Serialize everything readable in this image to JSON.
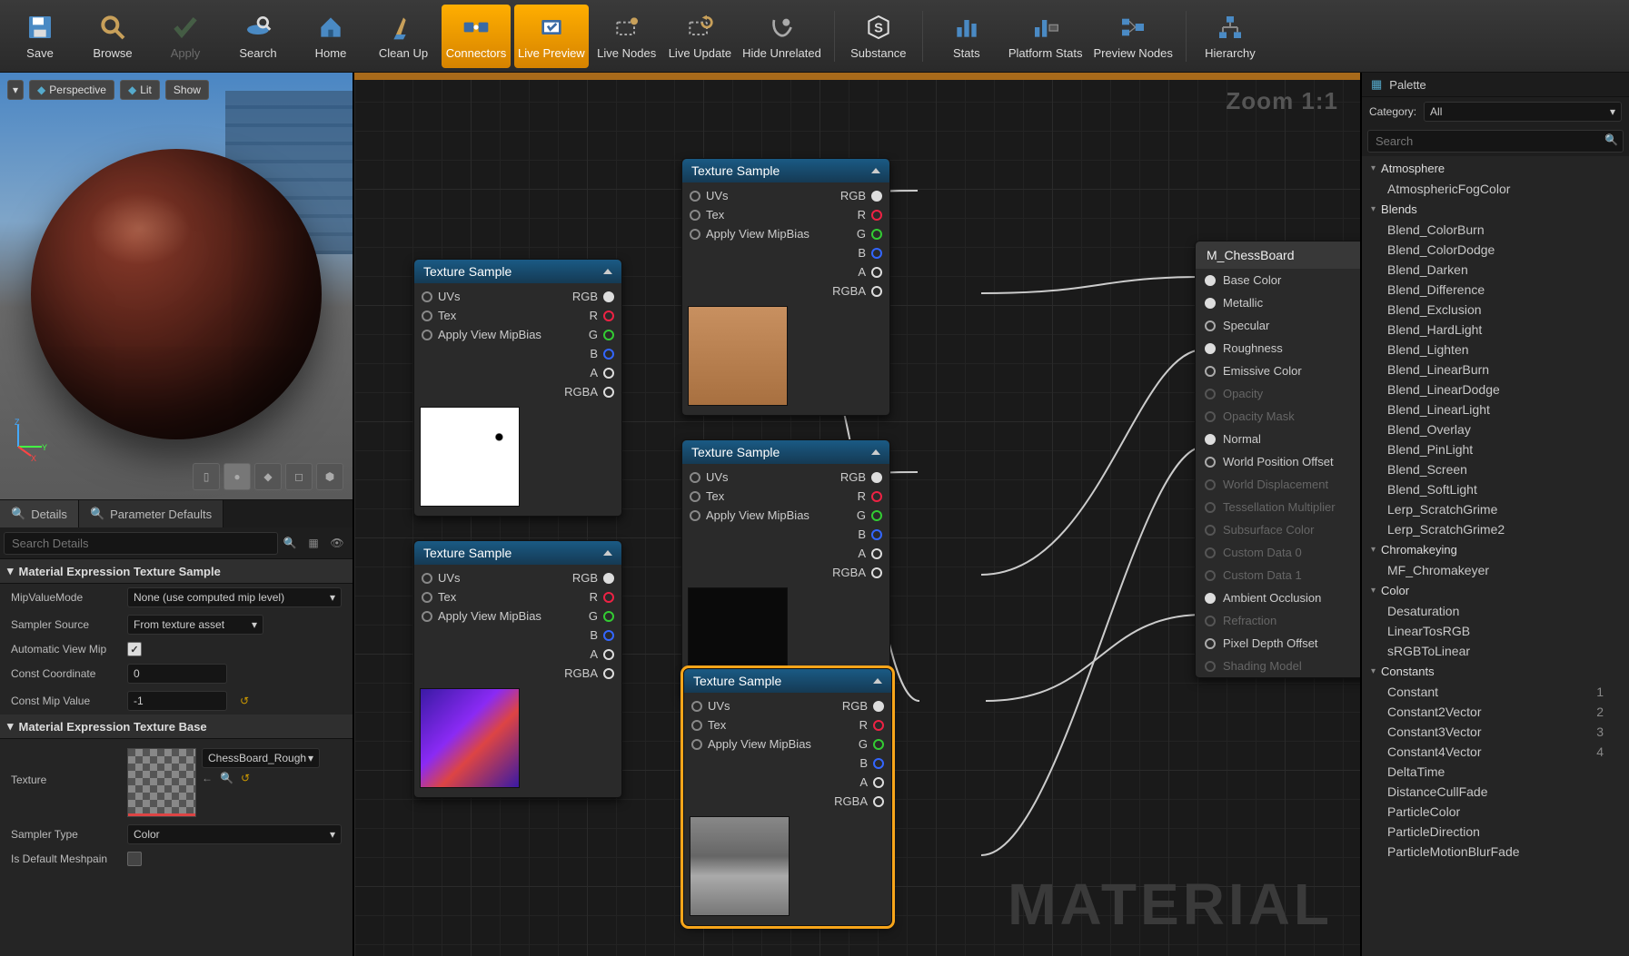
{
  "toolbar": [
    {
      "id": "save",
      "label": "Save",
      "icon": "floppy"
    },
    {
      "id": "browse",
      "label": "Browse",
      "icon": "browse"
    },
    {
      "id": "apply",
      "label": "Apply",
      "icon": "apply",
      "dim": true
    },
    {
      "id": "search",
      "label": "Search",
      "icon": "search"
    },
    {
      "id": "home",
      "label": "Home",
      "icon": "home"
    },
    {
      "id": "cleanup",
      "label": "Clean Up",
      "icon": "cleanup"
    },
    {
      "id": "connectors",
      "label": "Connectors",
      "icon": "connectors",
      "active": true
    },
    {
      "id": "livepreview",
      "label": "Live Preview",
      "icon": "preview",
      "active": true
    },
    {
      "id": "livenodes",
      "label": "Live Nodes",
      "icon": "livenodes"
    },
    {
      "id": "liveupdate",
      "label": "Live Update",
      "icon": "liveupdate"
    },
    {
      "id": "hideunrel",
      "label": "Hide Unrelated",
      "icon": "hide"
    },
    {
      "id": "substance",
      "label": "Substance",
      "icon": "substance",
      "sep": true
    },
    {
      "id": "stats",
      "label": "Stats",
      "icon": "stats",
      "sep": true
    },
    {
      "id": "platstats",
      "label": "Platform Stats",
      "icon": "platstats"
    },
    {
      "id": "prevnodes",
      "label": "Preview Nodes",
      "icon": "prevnodes"
    },
    {
      "id": "hierarchy",
      "label": "Hierarchy",
      "icon": "hierarchy",
      "sep": true
    }
  ],
  "viewport": {
    "menu_btn": "▾",
    "perspective": "Perspective",
    "lit": "Lit",
    "show": "Show"
  },
  "details_tabs": {
    "details": "Details",
    "paramdef": "Parameter Defaults"
  },
  "details_search_placeholder": "Search Details",
  "details": {
    "sec1": "Material Expression Texture Sample",
    "mipmode_lbl": "MipValueMode",
    "mipmode_val": "None (use computed mip level)",
    "sampler_lbl": "Sampler Source",
    "sampler_val": "From texture asset",
    "autoview_lbl": "Automatic View Mip",
    "autoview_checked": true,
    "constcoord_lbl": "Const Coordinate",
    "constcoord_val": "0",
    "constmip_lbl": "Const Mip Value",
    "constmip_val": "-1",
    "sec2": "Material Expression Texture Base",
    "texture_lbl": "Texture",
    "texture_val": "ChessBoard_Rough",
    "samplertype_lbl": "Sampler Type",
    "samplertype_val": "Color",
    "defaultmesh_lbl": "Is Default Meshpain"
  },
  "graph": {
    "zoom": "Zoom 1:1",
    "watermark": "MATERIAL",
    "texsample_hdr": "Texture Sample",
    "pins_in": [
      "UVs",
      "Tex",
      "Apply View MipBias"
    ],
    "pins_out": [
      "RGB",
      "R",
      "G",
      "B",
      "A",
      "RGBA"
    ],
    "matnode_title": "M_ChessBoard",
    "mat_inputs": [
      {
        "label": "Base Color",
        "filled": true
      },
      {
        "label": "Metallic",
        "filled": true
      },
      {
        "label": "Specular",
        "ring": true
      },
      {
        "label": "Roughness",
        "filled": true
      },
      {
        "label": "Emissive Color",
        "ring": true
      },
      {
        "label": "Opacity",
        "dim": true
      },
      {
        "label": "Opacity Mask",
        "dim": true
      },
      {
        "label": "Normal",
        "filled": true
      },
      {
        "label": "World Position Offset",
        "ring": true
      },
      {
        "label": "World Displacement",
        "dim": true
      },
      {
        "label": "Tessellation Multiplier",
        "dim": true
      },
      {
        "label": "Subsurface Color",
        "dim": true
      },
      {
        "label": "Custom Data 0",
        "dim": true
      },
      {
        "label": "Custom Data 1",
        "dim": true
      },
      {
        "label": "Ambient Occlusion",
        "filled": true
      },
      {
        "label": "Refraction",
        "dim": true
      },
      {
        "label": "Pixel Depth Offset",
        "ring": true
      },
      {
        "label": "Shading Model",
        "dim": true
      }
    ]
  },
  "palette": {
    "tab": "Palette",
    "category_lbl": "Category:",
    "category_val": "All",
    "search_placeholder": "Search",
    "groups": [
      {
        "name": "Atmosphere",
        "items": [
          {
            "n": "AtmosphericFogColor"
          }
        ]
      },
      {
        "name": "Blends",
        "items": [
          {
            "n": "Blend_ColorBurn"
          },
          {
            "n": "Blend_ColorDodge"
          },
          {
            "n": "Blend_Darken"
          },
          {
            "n": "Blend_Difference"
          },
          {
            "n": "Blend_Exclusion"
          },
          {
            "n": "Blend_HardLight"
          },
          {
            "n": "Blend_Lighten"
          },
          {
            "n": "Blend_LinearBurn"
          },
          {
            "n": "Blend_LinearDodge"
          },
          {
            "n": "Blend_LinearLight"
          },
          {
            "n": "Blend_Overlay"
          },
          {
            "n": "Blend_PinLight"
          },
          {
            "n": "Blend_Screen"
          },
          {
            "n": "Blend_SoftLight"
          },
          {
            "n": "Lerp_ScratchGrime"
          },
          {
            "n": "Lerp_ScratchGrime2"
          }
        ]
      },
      {
        "name": "Chromakeying",
        "items": [
          {
            "n": "MF_Chromakeyer"
          }
        ]
      },
      {
        "name": "Color",
        "items": [
          {
            "n": "Desaturation"
          },
          {
            "n": "LinearTosRGB"
          },
          {
            "n": "sRGBToLinear"
          }
        ]
      },
      {
        "name": "Constants",
        "items": [
          {
            "n": "Constant",
            "sc": "1"
          },
          {
            "n": "Constant2Vector",
            "sc": "2"
          },
          {
            "n": "Constant3Vector",
            "sc": "3"
          },
          {
            "n": "Constant4Vector",
            "sc": "4"
          },
          {
            "n": "DeltaTime"
          },
          {
            "n": "DistanceCullFade"
          },
          {
            "n": "ParticleColor"
          },
          {
            "n": "ParticleDirection"
          },
          {
            "n": "ParticleMotionBlurFade"
          }
        ]
      }
    ]
  }
}
